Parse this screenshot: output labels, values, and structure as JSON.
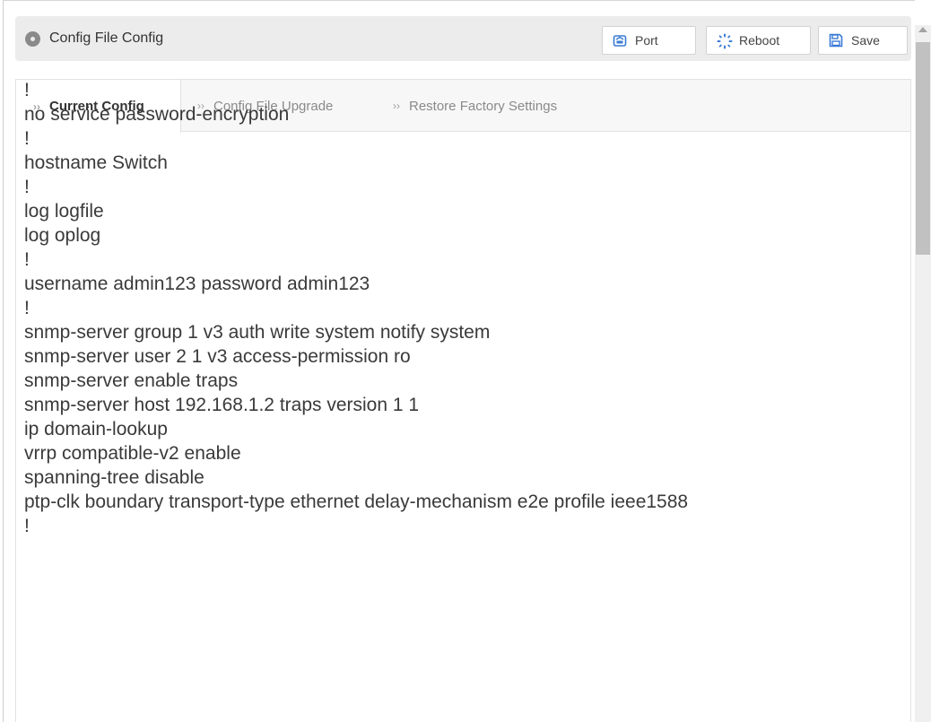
{
  "header": {
    "title": "Config File Config",
    "buttons": {
      "port": "Port",
      "reboot": "Reboot",
      "save": "Save"
    }
  },
  "tabs": [
    {
      "label": "Current Config",
      "active": true
    },
    {
      "label": "Config File Upgrade",
      "active": false
    },
    {
      "label": "Restore Factory Settings",
      "active": false
    }
  ],
  "config_lines": [
    "!",
    "no service password-encryption",
    "!",
    "hostname Switch",
    "!",
    "log logfile",
    "log oplog",
    "!",
    "username admin123 password admin123",
    "!",
    "snmp-server group 1 v3 auth write system notify system",
    "snmp-server user 2 1 v3 access-permission ro",
    "snmp-server enable traps",
    "snmp-server host 192.168.1.2 traps version 1 1",
    "ip domain-lookup",
    "vrrp compatible-v2 enable",
    "spanning-tree disable",
    "ptp-clk boundary transport-type ethernet delay-mechanism e2e profile ieee1588",
    "!"
  ],
  "icons": {
    "header": "circle-dot-icon",
    "port": "port-icon",
    "reboot": "reboot-spinner-icon",
    "save": "floppy-save-icon",
    "tab": "chevron-right-icon"
  },
  "colors": {
    "accent": "#3a7bd5",
    "header_bg": "#ececec",
    "tab_bg": "#f7f7f7",
    "text": "#3a3a3a"
  }
}
